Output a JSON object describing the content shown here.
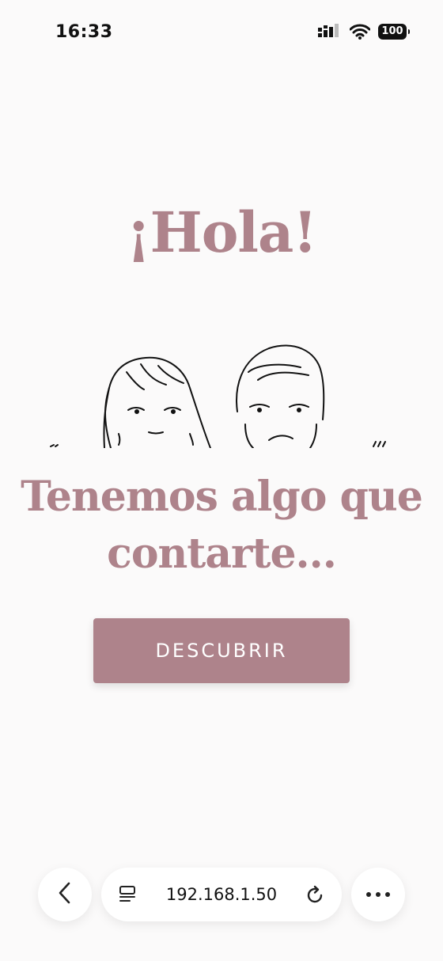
{
  "status_bar": {
    "time": "16:33",
    "battery": "100",
    "icons": [
      "signal-icon",
      "wifi-icon",
      "battery-icon"
    ]
  },
  "main": {
    "greeting": "¡Hola!",
    "tagline": "Tenemos algo que contarte...",
    "cta_label": "DESCUBRIR",
    "illustration": "couple-line-drawing"
  },
  "browser": {
    "url": "192.168.1.50",
    "icons": [
      "back-arrow-icon",
      "tab-icon",
      "reload-icon",
      "more-icon"
    ]
  },
  "colors": {
    "accent": "#ae838b",
    "background": "#fbfafa",
    "button_text": "#ffffff"
  }
}
